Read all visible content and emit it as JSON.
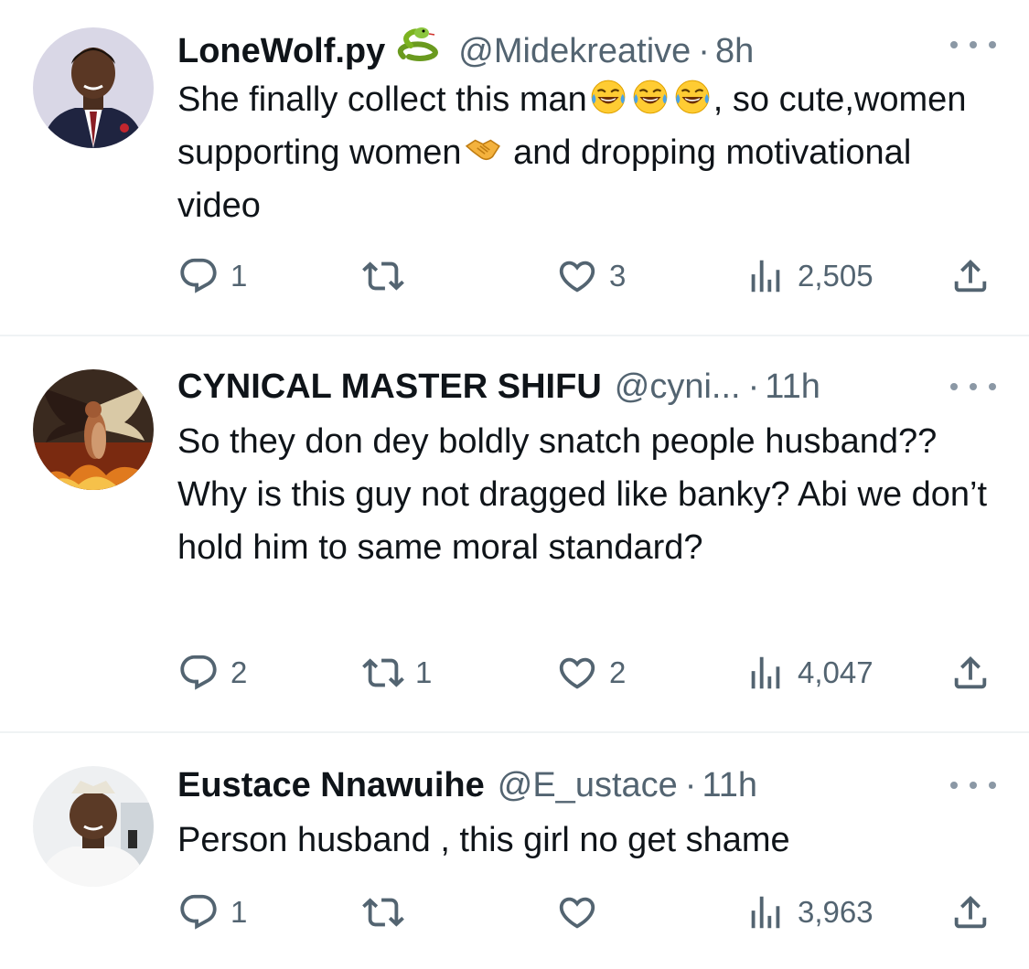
{
  "tweets": [
    {
      "name": "LoneWolf.py",
      "handle": "@Midekreative",
      "dot": "·",
      "time": "8h",
      "text": {
        "part1": "She finally collect this man",
        "part2": ", so cute,women supporting women",
        "part3": " and dropping motivational video"
      },
      "replies": "1",
      "retweets": "",
      "likes": "3",
      "views": "2,505"
    },
    {
      "name": "CYNICAL MASTER SHIFU",
      "handle": "@cyni...",
      "dot": "·",
      "time": "11h",
      "text": "So they don dey boldly snatch people husband?? Why is this guy not dragged like banky? Abi we don’t hold him to same moral standard?",
      "replies": "2",
      "retweets": "1",
      "likes": "2",
      "views": "4,047"
    },
    {
      "name": "Eustace Nnawuihe",
      "handle": "@E_ustace",
      "dot": "·",
      "time": "11h",
      "text": "Person husband , this girl no get shame",
      "replies": "1",
      "retweets": "",
      "likes": "",
      "views": "3,963"
    }
  ],
  "icons": {
    "reply": "reply-icon",
    "retweet": "retweet-icon",
    "like": "heart-icon",
    "views": "views-icon",
    "share": "share-icon",
    "more": "more-icon"
  },
  "colors": {
    "text": "#0f1419",
    "muted": "#536471",
    "divider": "#eff3f4"
  }
}
